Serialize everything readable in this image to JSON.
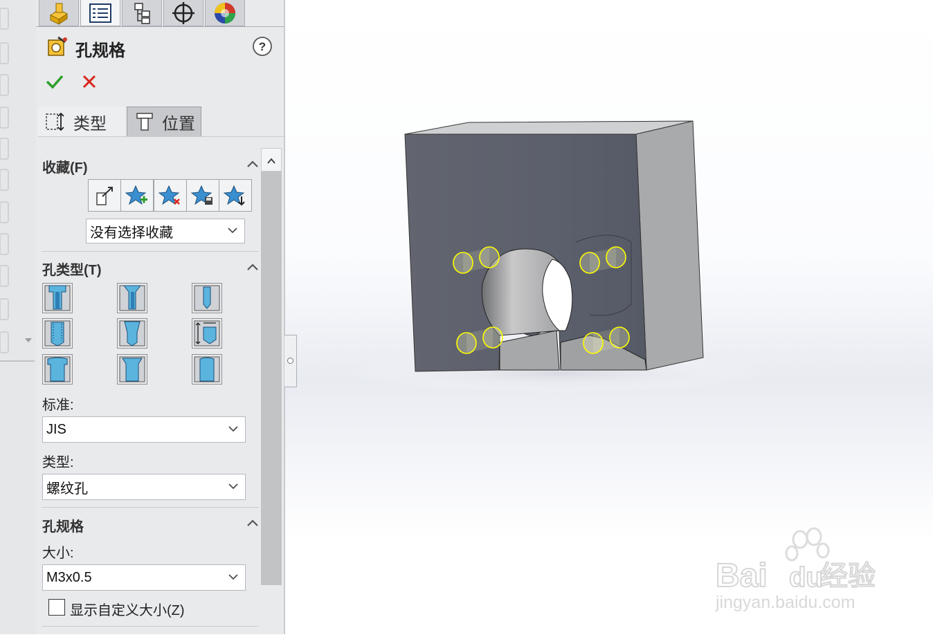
{
  "property_manager": {
    "tabs": [
      {
        "icon": "feature-manager-icon",
        "active": false
      },
      {
        "icon": "property-manager-icon",
        "active": true
      },
      {
        "icon": "configuration-manager-icon",
        "active": false
      },
      {
        "icon": "dimxpert-manager-icon",
        "active": false
      },
      {
        "icon": "display-manager-icon",
        "active": false
      }
    ],
    "title": "孔规格",
    "help_icon": "help-icon",
    "ok_icon": "checkmark-icon",
    "cancel_icon": "close-icon",
    "subtabs": [
      {
        "label": "类型",
        "active": true
      },
      {
        "label": "位置",
        "active": false
      }
    ]
  },
  "favorites": {
    "heading": "收藏(F)",
    "buttons": [
      "apply-defaults-icon",
      "add-favorite-icon",
      "delete-favorite-icon",
      "save-favorite-icon",
      "load-favorite-icon"
    ],
    "selected": "没有选择收藏"
  },
  "hole_type": {
    "heading": "孔类型(T)",
    "types": [
      "counterbore-icon",
      "countersink-icon",
      "hole-icon",
      "straight-tap-icon",
      "tapered-tap-icon",
      "legacy-hole-icon",
      "counterbore-slot-icon",
      "countersink-slot-icon",
      "slot-icon"
    ],
    "standard_label": "标准:",
    "standard_value": "JIS",
    "type_label": "类型:",
    "type_value": "螺纹孔"
  },
  "hole_spec": {
    "heading": "孔规格",
    "size_label": "大小:",
    "size_value": "M3x0.5",
    "custom_size_label": "显示自定义大小(Z)",
    "custom_size_checked": false
  },
  "watermark": {
    "brand": "Bai",
    "brand_suffix": "du",
    "product": "经验",
    "url": "jingyan.baidu.com"
  },
  "colors": {
    "accent_green": "#2e9e2e",
    "accent_red": "#d9251c",
    "hole_preview": "#ffff00",
    "model_face": "#5f6370",
    "model_side": "#a9aaab"
  }
}
